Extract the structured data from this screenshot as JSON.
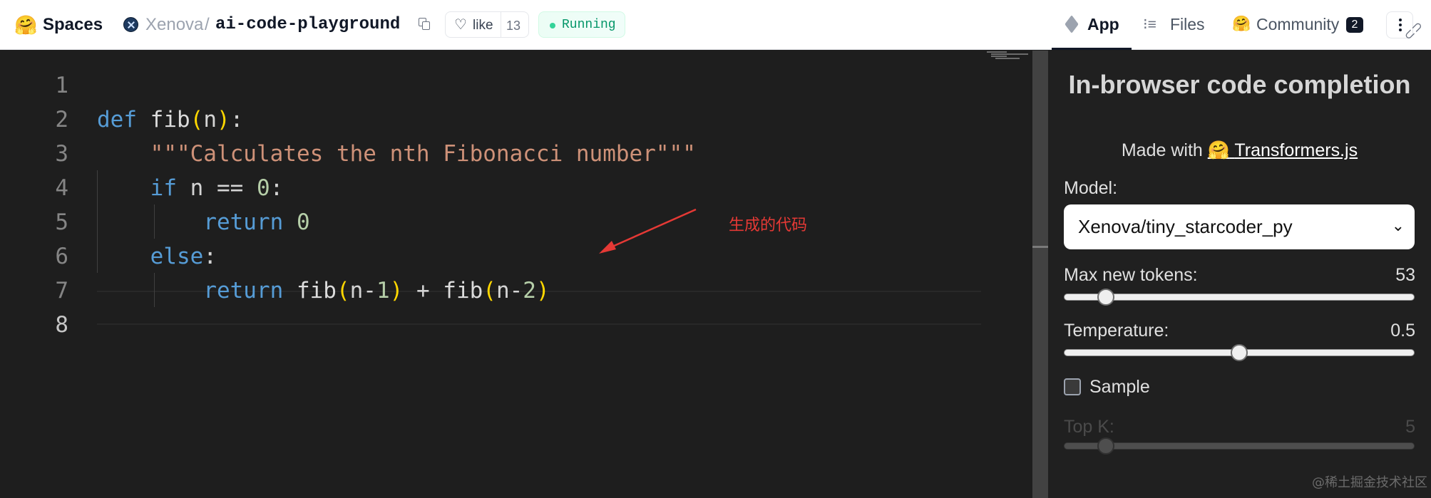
{
  "header": {
    "logo_emoji": "🤗",
    "spaces_label": "Spaces",
    "owner": "Xenova",
    "separator": "/",
    "repo": "ai-code-playground",
    "like_label": "like",
    "like_count": "13",
    "status": "Running",
    "tabs": [
      {
        "label": "App",
        "icon": "cube-icon",
        "active": true
      },
      {
        "label": "Files",
        "icon": "files-icon",
        "active": false
      },
      {
        "label": "Community",
        "icon": "community-icon",
        "badge": "2",
        "active": false
      }
    ]
  },
  "editor": {
    "line_numbers": [
      "1",
      "2",
      "3",
      "4",
      "5",
      "6",
      "7",
      "8"
    ],
    "active_line": "8",
    "lines": [
      [],
      [
        {
          "t": "def",
          "c": "kw"
        },
        {
          "t": " ",
          "c": ""
        },
        {
          "t": "fib",
          "c": "fnw"
        },
        {
          "t": "(",
          "c": "br"
        },
        {
          "t": "n",
          "c": ""
        },
        {
          "t": ")",
          "c": "br"
        },
        {
          "t": ":",
          "c": ""
        }
      ],
      [
        {
          "t": "    ",
          "c": ""
        },
        {
          "t": "\"\"\"Calculates the nth Fibonacci number\"\"\"",
          "c": "str"
        }
      ],
      [
        {
          "t": "    ",
          "c": ""
        },
        {
          "t": "if",
          "c": "kw"
        },
        {
          "t": " n == ",
          "c": ""
        },
        {
          "t": "0",
          "c": "num"
        },
        {
          "t": ":",
          "c": ""
        }
      ],
      [
        {
          "t": "        ",
          "c": ""
        },
        {
          "t": "return",
          "c": "kw"
        },
        {
          "t": " ",
          "c": ""
        },
        {
          "t": "0",
          "c": "num"
        }
      ],
      [
        {
          "t": "    ",
          "c": ""
        },
        {
          "t": "else",
          "c": "kw"
        },
        {
          "t": ":",
          "c": ""
        }
      ],
      [
        {
          "t": "        ",
          "c": ""
        },
        {
          "t": "return",
          "c": "kw"
        },
        {
          "t": " fib",
          "c": "fnw"
        },
        {
          "t": "(",
          "c": "br"
        },
        {
          "t": "n-",
          "c": ""
        },
        {
          "t": "1",
          "c": "num"
        },
        {
          "t": ")",
          "c": "br"
        },
        {
          "t": " + ",
          "c": ""
        },
        {
          "t": "fib",
          "c": "fnw"
        },
        {
          "t": "(",
          "c": "br"
        },
        {
          "t": "n-",
          "c": ""
        },
        {
          "t": "2",
          "c": "num"
        },
        {
          "t": ")",
          "c": "br"
        }
      ],
      []
    ],
    "annotation": "生成的代码",
    "annotation_color": "#e53935"
  },
  "panel": {
    "title": "In-browser code completion",
    "made_with_prefix": "Made with",
    "made_with_emoji": "🤗",
    "made_with_link": "Transformers.js",
    "model_label": "Model:",
    "model_value": "Xenova/tiny_starcoder_py",
    "max_tokens_label": "Max new tokens:",
    "max_tokens_value": "53",
    "max_tokens_fraction": 0.12,
    "temperature_label": "Temperature:",
    "temperature_value": "0.5",
    "temperature_fraction": 0.5,
    "sample_label": "Sample",
    "sample_checked": false,
    "topk_label": "Top K:",
    "topk_value": "5",
    "topk_fraction": 0.12
  },
  "watermark": "@稀土掘金技术社区"
}
